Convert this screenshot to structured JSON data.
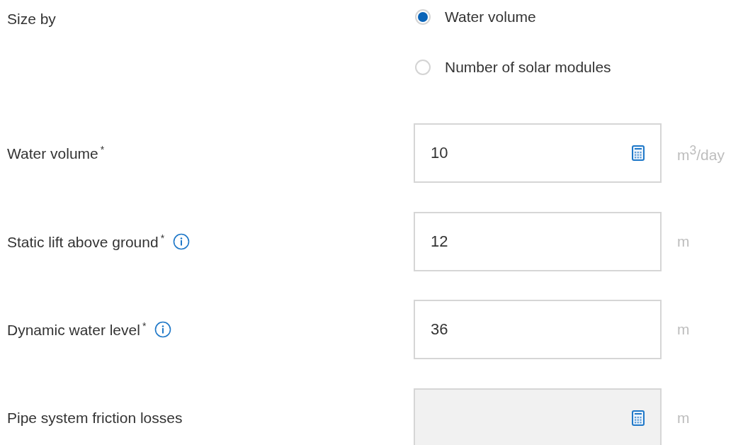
{
  "size_by": {
    "label": "Size by",
    "options": [
      {
        "label": "Water volume",
        "selected": true
      },
      {
        "label": "Number of solar modules",
        "selected": false
      }
    ]
  },
  "fields": [
    {
      "label": "Water volume",
      "required_mark": "*",
      "info": false,
      "value": "10",
      "calculator": true,
      "disabled": false,
      "unit": "m$^{3}$/day"
    },
    {
      "label": "Static lift above ground",
      "required_mark": "*",
      "info": true,
      "value": "12",
      "calculator": false,
      "disabled": false,
      "unit": "m"
    },
    {
      "label": "Dynamic water level",
      "required_mark": "*",
      "info": true,
      "value": "36",
      "calculator": false,
      "disabled": false,
      "unit": "m"
    },
    {
      "label": "Pipe system friction losses",
      "info": false,
      "calculator": true,
      "disabled": true,
      "unit": "m"
    }
  ]
}
